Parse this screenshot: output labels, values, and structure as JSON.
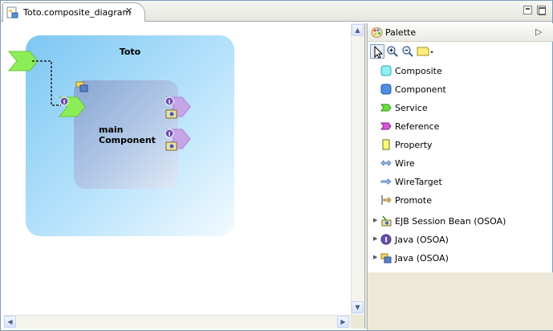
{
  "editor": {
    "tab_title": "Toto.composite_diagram",
    "tab_icon": "composite-diagram-file-icon",
    "close_icon": "close-x-icon"
  },
  "diagram": {
    "composite_name": "Toto",
    "component_name": "main\nComponent",
    "colors": {
      "composite": "#9cd6f8",
      "component": "#a5bddf",
      "service": "#7be84a",
      "reference": "#c9a7e8",
      "wire": "#000000"
    }
  },
  "palette": {
    "title": "Palette",
    "title_icon": "palette-icon",
    "toolbar": [
      {
        "name": "select-tool",
        "icon": "arrow-cursor-icon"
      },
      {
        "name": "zoom-in-tool",
        "icon": "zoom-in-icon"
      },
      {
        "name": "zoom-out-tool",
        "icon": "zoom-out-icon"
      },
      {
        "name": "note-tool",
        "icon": "note-icon"
      }
    ],
    "items": [
      {
        "label": "Composite",
        "icon": "composite-icon"
      },
      {
        "label": "Component",
        "icon": "component-icon"
      },
      {
        "label": "Service",
        "icon": "service-icon"
      },
      {
        "label": "Reference",
        "icon": "reference-icon"
      },
      {
        "label": "Property",
        "icon": "property-icon"
      },
      {
        "label": "Wire",
        "icon": "wire-icon"
      },
      {
        "label": "WireTarget",
        "icon": "wire-target-icon"
      },
      {
        "label": "Promote",
        "icon": "promote-icon"
      },
      {
        "label": "EJB Session Bean (OSOA)",
        "icon": "ejb-session-bean-icon",
        "expandable": true
      },
      {
        "label": "Java (OSOA)",
        "icon": "java-interface-icon",
        "expandable": true
      },
      {
        "label": "Java (OSOA)",
        "icon": "java-implementation-icon",
        "expandable": true
      }
    ]
  }
}
